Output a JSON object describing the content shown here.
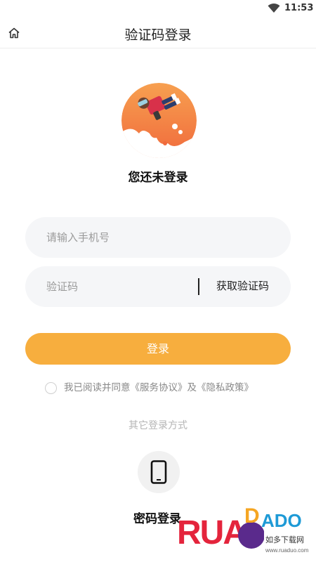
{
  "status_bar": {
    "time": "11:53",
    "wifi_icon": "wifi-icon"
  },
  "header": {
    "title": "验证码登录",
    "home_icon": "home-icon"
  },
  "profile": {
    "status_text": "您还未登录",
    "avatar": "rocket-man-illustration"
  },
  "form": {
    "phone_placeholder": "请输入手机号",
    "phone_value": "",
    "code_placeholder": "验证码",
    "code_value": "",
    "get_code_label": "获取验证码"
  },
  "login_button": {
    "label": "登录",
    "color": "#f7ae3e"
  },
  "agreement": {
    "prefix": "我已阅读并同意",
    "service_link": "《服务协议》",
    "conjunction": "及",
    "privacy_link": "《隐私政策》",
    "checked": false
  },
  "other_login": {
    "title": "其它登录方式",
    "password_label": "密码登录",
    "password_icon": "phone-icon"
  },
  "watermark": {
    "brand": "RUANDADO",
    "chinese": "如多下载网",
    "url": "www.ruaduo.com"
  }
}
